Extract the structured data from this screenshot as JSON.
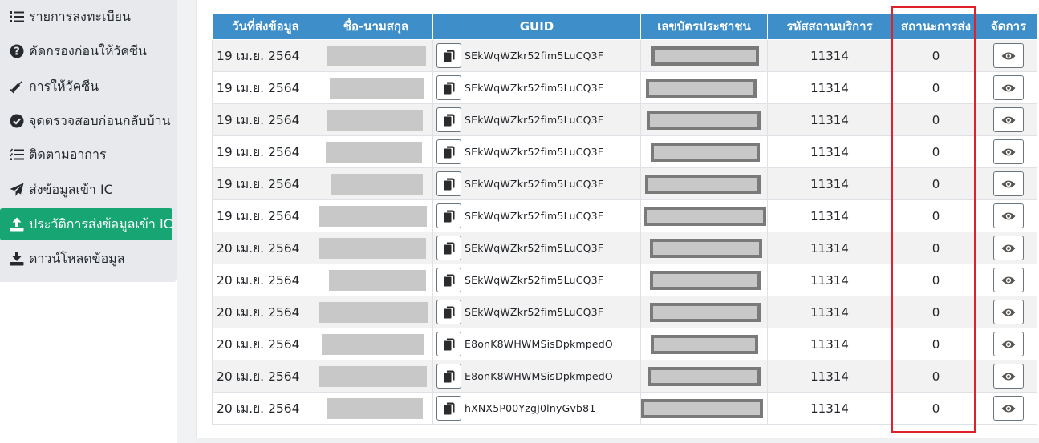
{
  "sidebar": {
    "items": [
      {
        "label": "รายการลงทะเบียน",
        "icon": "list-icon",
        "active": false
      },
      {
        "label": "คัดกรองก่อนให้วัคซีน",
        "icon": "question-circle-icon",
        "active": false
      },
      {
        "label": "การให้วัคซีน",
        "icon": "syringe-icon",
        "active": false
      },
      {
        "label": "จุดตรวจสอบก่อนกลับบ้าน",
        "icon": "check-circle-icon",
        "active": false
      },
      {
        "label": "ติดตามอาการ",
        "icon": "tasks-icon",
        "active": false
      },
      {
        "label": "ส่งข้อมูลเข้า IC",
        "icon": "paper-plane-icon",
        "active": false
      },
      {
        "label": "ประวัติการส่งข้อมูลเข้า IC",
        "icon": "upload-icon",
        "active": true
      },
      {
        "label": "ดาวน์โหลดข้อมูล",
        "icon": "download-icon",
        "active": false
      }
    ]
  },
  "table": {
    "headers": {
      "date": "วันที่ส่งข้อมูล",
      "name": "ชื่อ-นามสกุล",
      "guid": "GUID",
      "citizen_id": "เลขบัตรประชาชน",
      "service_code": "รหัสสถานบริการ",
      "status": "สถานะการส่ง",
      "actions": "จัดการ"
    },
    "rows": [
      {
        "date": "19 เม.ย. 2564",
        "guid": "SEkWqWZkr52fim5LuCQ3F",
        "service_code": "11314",
        "status": "0"
      },
      {
        "date": "19 เม.ย. 2564",
        "guid": "SEkWqWZkr52fim5LuCQ3F",
        "service_code": "11314",
        "status": "0"
      },
      {
        "date": "19 เม.ย. 2564",
        "guid": "SEkWqWZkr52fim5LuCQ3F",
        "service_code": "11314",
        "status": "0"
      },
      {
        "date": "19 เม.ย. 2564",
        "guid": "SEkWqWZkr52fim5LuCQ3F",
        "service_code": "11314",
        "status": "0"
      },
      {
        "date": "19 เม.ย. 2564",
        "guid": "SEkWqWZkr52fim5LuCQ3F",
        "service_code": "11314",
        "status": "0"
      },
      {
        "date": "19 เม.ย. 2564",
        "guid": "SEkWqWZkr52fim5LuCQ3F",
        "service_code": "11314",
        "status": "0"
      },
      {
        "date": "20 เม.ย. 2564",
        "guid": "SEkWqWZkr52fim5LuCQ3F",
        "service_code": "11314",
        "status": "0"
      },
      {
        "date": "20 เม.ย. 2564",
        "guid": "SEkWqWZkr52fim5LuCQ3F",
        "service_code": "11314",
        "status": "0"
      },
      {
        "date": "20 เม.ย. 2564",
        "guid": "SEkWqWZkr52fim5LuCQ3F",
        "service_code": "11314",
        "status": "0"
      },
      {
        "date": "20 เม.ย. 2564",
        "guid": "E8onK8WHWMSisDpkmpedO",
        "service_code": "11314",
        "status": "0"
      },
      {
        "date": "20 เม.ย. 2564",
        "guid": "E8onK8WHWMSisDpkmpedO",
        "service_code": "11314",
        "status": "0"
      },
      {
        "date": "20 เม.ย. 2564",
        "guid": "hXNX5P00YzgJ0lnyGvb81",
        "service_code": "11314",
        "status": "0"
      }
    ]
  },
  "colors": {
    "header_bg": "#3d8ec9",
    "active_menu": "#17a673",
    "highlight_border": "#e0202a",
    "sidebar_bg": "#e7e9ec"
  }
}
